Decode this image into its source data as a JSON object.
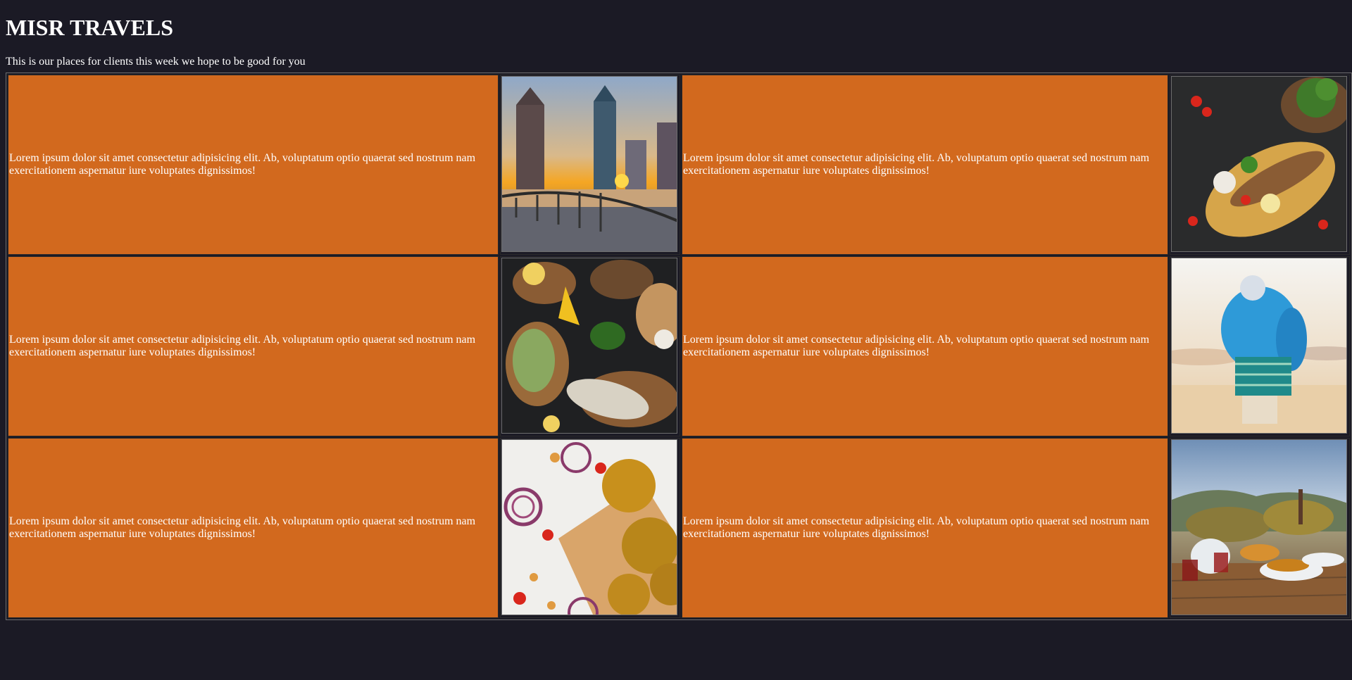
{
  "header": {
    "title": "MISR TRAVELS",
    "subtitle": "This is our places for clients this week we hope to be good for you"
  },
  "rows": [
    {
      "left_text": "Lorem ipsum dolor sit amet consectetur adipisicing elit. Ab, voluptatum optio quaerat sed nostrum nam exercitationem aspernatur iure voluptates dignissimos!",
      "left_image": "city-skyline-sunset-image",
      "right_text": "Lorem ipsum dolor sit amet consectetur adipisicing elit. Ab, voluptatum optio quaerat sed nostrum nam exercitationem aspernatur iure voluptates dignissimos!",
      "right_image": "grilled-fish-plate-image"
    },
    {
      "left_text": "Lorem ipsum dolor sit amet consectetur adipisicing elit. Ab, voluptatum optio quaerat sed nostrum nam exercitationem aspernatur iure voluptates dignissimos!",
      "left_image": "smoked-fish-spread-image",
      "right_text": "Lorem ipsum dolor sit amet consectetur adipisicing elit. Ab, voluptatum optio quaerat sed nostrum nam exercitationem aspernatur iure voluptates dignissimos!",
      "right_image": "man-in-blue-robe-image"
    },
    {
      "left_text": "Lorem ipsum dolor sit amet consectetur adipisicing elit. Ab, voluptatum optio quaerat sed nostrum nam exercitationem aspernatur iure voluptates dignissimos!",
      "left_image": "falafel-patties-image",
      "right_text": "Lorem ipsum dolor sit amet consectetur adipisicing elit. Ab, voluptatum optio quaerat sed nostrum nam exercitationem aspernatur iure voluptates dignissimos!",
      "right_image": "tea-and-sweets-table-image"
    }
  ],
  "colors": {
    "background": "#1b1a25",
    "cell": "#d2691e",
    "text": "#ffffff"
  }
}
